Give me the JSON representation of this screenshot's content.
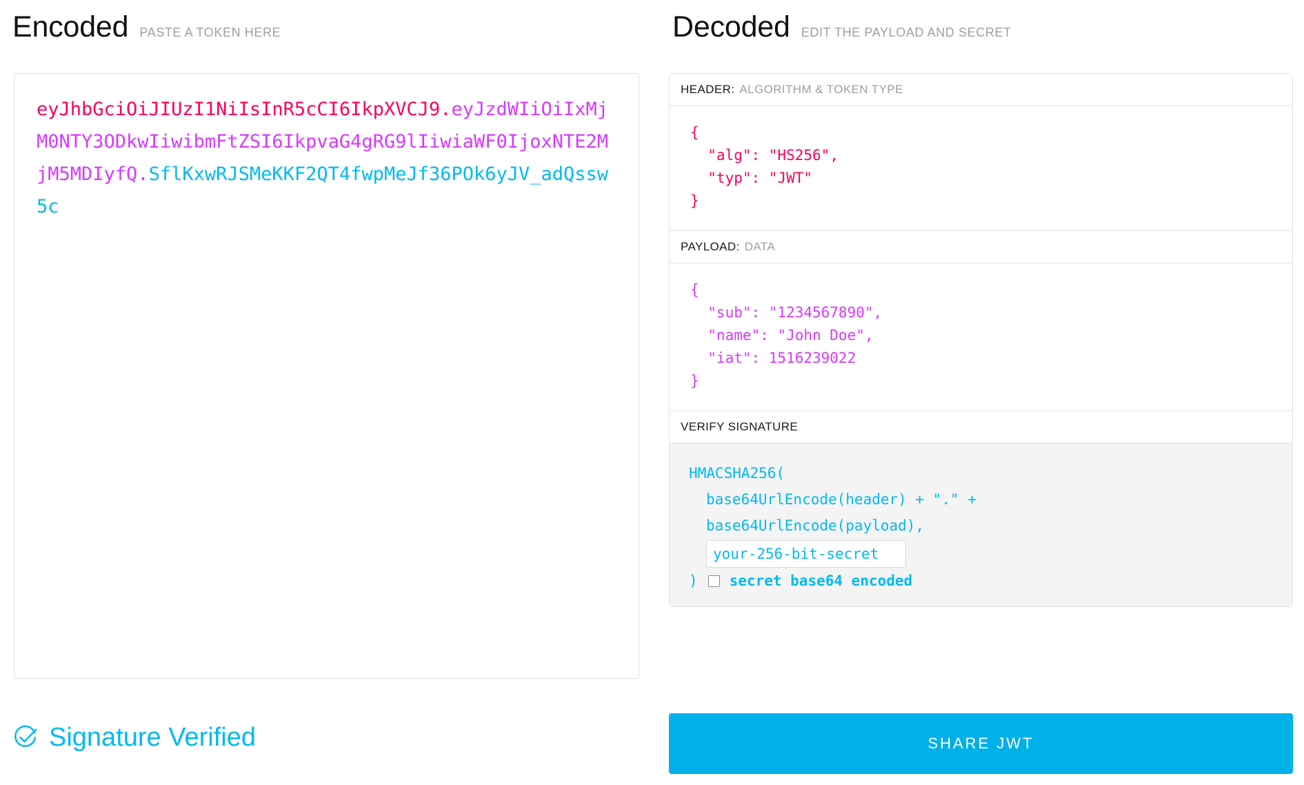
{
  "encoded": {
    "title": "Encoded",
    "subtitle": "PASTE A TOKEN HERE",
    "token": {
      "header": "eyJhbGciOiJIUzI1NiIsInR5cCI6IkpXVCJ9",
      "dot1": ".",
      "payload": "eyJzdWIiOiIxMjM0NTY3ODkwIiwibmFtZSI6IkpvaG4gRG9lIiwiaWF0IjoxNTE2MjM5MDIyfQ",
      "dot2": ".",
      "signature": "SflKxwRJSMeKKF2QT4fwpMeJf36POk6yJV_adQssw5c"
    }
  },
  "decoded": {
    "title": "Decoded",
    "subtitle": "EDIT THE PAYLOAD AND SECRET",
    "header_section": {
      "label_key": "HEADER:",
      "label_value": "ALGORITHM & TOKEN TYPE",
      "code": "{\n  \"alg\": \"HS256\",\n  \"typ\": \"JWT\"\n}"
    },
    "payload_section": {
      "label_key": "PAYLOAD:",
      "label_value": "DATA",
      "code": "{\n  \"sub\": \"1234567890\",\n  \"name\": \"John Doe\",\n  \"iat\": 1516239022\n}"
    },
    "signature_section": {
      "label_key": "VERIFY SIGNATURE",
      "line1": "HMACSHA256(",
      "line2": "base64UrlEncode(header) + \".\" +",
      "line3": "base64UrlEncode(payload),",
      "secret_value": "your-256-bit-secret",
      "secret_placeholder": "your-256-bit-secret",
      "close_paren": ")",
      "base64_label": "secret base64 encoded",
      "base64_checked": false
    }
  },
  "footer": {
    "status_text": "Signature Verified",
    "share_button_label": "SHARE JWT"
  },
  "colors": {
    "header_token": "#fb015b",
    "payload_token": "#d63aff",
    "signature_token": "#00b9f1",
    "accent": "#00b0e8",
    "muted_text": "#9aa0a6",
    "panel_border": "#e0e0e0",
    "signature_bg": "#f4f4f4"
  }
}
